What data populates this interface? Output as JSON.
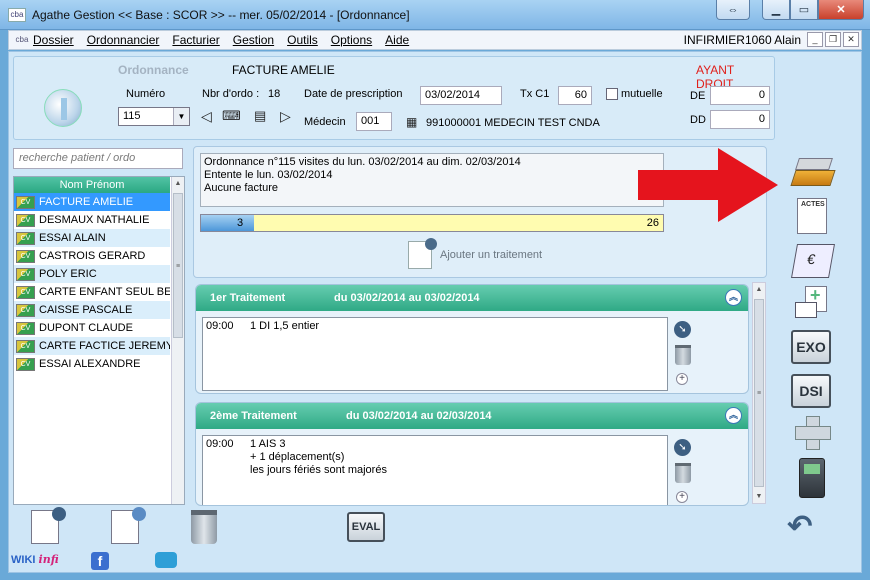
{
  "window": {
    "icon_text": "cba",
    "title": "Agathe Gestion << Base : SCOR >>   --   mer. 05/02/2014  - [Ordonnance]"
  },
  "menu": {
    "items": [
      "Dossier",
      "Ordonnancier",
      "Facturier",
      "Gestion",
      "Outils",
      "Options",
      "Aide"
    ],
    "user": "INFIRMIER1060 Alain"
  },
  "header": {
    "ordonnance_label": "Ordonnance",
    "patient_name": "FACTURE AMELIE",
    "ayant_droit": "AYANT DROIT",
    "numero_label": "Numéro",
    "numero_value": "115",
    "nbr_ordo_label": "Nbr d'ordo :",
    "nbr_ordo_value": "18",
    "date_prescription_label": "Date de prescription",
    "date_prescription_value": "03/02/2014",
    "txc1_label": "Tx C1",
    "txc1_value": "60",
    "mutuelle_label": "mutuelle",
    "de_label": "DE",
    "de_value": "0",
    "dd_label": "DD",
    "dd_value": "0",
    "medecin_label": "Médecin",
    "medecin_code": "001",
    "medecin_name": "991000001 MEDECIN TEST CNDA"
  },
  "search": {
    "placeholder": "recherche patient / ordo"
  },
  "patients": {
    "header": "Nom Prénom",
    "card_label": "CV",
    "rows": [
      "FACTURE AMELIE",
      "DESMAUX NATHALIE",
      "ESSAI ALAIN",
      "CASTROIS GERARD",
      "POLY ERIC",
      "CARTE ENFANT SEUL BEN",
      "CAISSE PASCALE",
      "DUPONT CLAUDE",
      "CARTE FACTICE JEREMY",
      "ESSAI ALEXANDRE"
    ],
    "selected_index": 0
  },
  "summary": {
    "line1": "Ordonnance n°115    visites du lun. 03/02/2014 au dim. 02/03/2014",
    "line2": "Entente le lun. 03/02/2014",
    "line3": "Aucune facture",
    "progress_done": "3",
    "progress_total": "26",
    "progress_fraction": 0.115,
    "add_treatment": "Ajouter un traitement"
  },
  "treatments": [
    {
      "title": "1er Traitement",
      "period": "du 03/02/2014 au 03/02/2014",
      "lines": [
        {
          "time": "09:00",
          "text": "1 DI 1,5 entier"
        }
      ]
    },
    {
      "title": "2ème Traitement",
      "period": "du 03/02/2014 au 02/03/2014",
      "lines": [
        {
          "time": "09:00",
          "text": "1 AIS 3"
        },
        {
          "time": "",
          "text": "+ 1 déplacement(s)"
        },
        {
          "time": "",
          "text": "les jours fériés sont majorés"
        }
      ]
    }
  ],
  "toolbar": {
    "actes_label": "ACTES",
    "exo_label": "EXO",
    "dsi_label": "DSI",
    "eval_label": "EVAL"
  },
  "footer": {
    "wiki": "WIKI",
    "inf": "infi",
    "fb": "f"
  },
  "colors": {
    "accent_green": "#2fa985",
    "selection": "#3399ff",
    "arrow_red": "#e5141d",
    "progress_yellow": "#fffcb0"
  }
}
